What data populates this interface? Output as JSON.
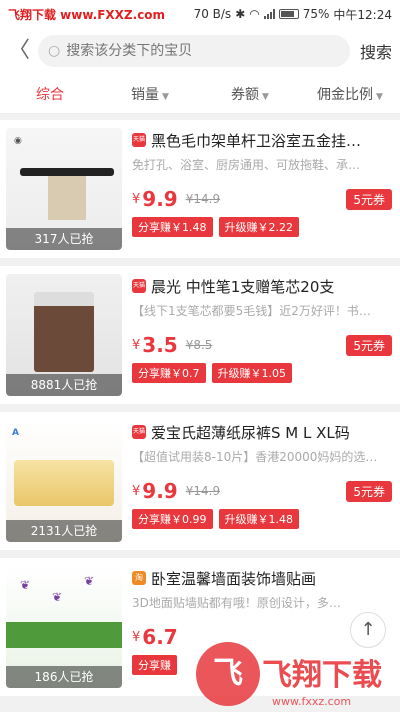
{
  "status_bar": {
    "watermark": "飞翔下载 www.FXXZ.com",
    "speed": "70 B/s",
    "battery": "75%",
    "time": "中午12:24"
  },
  "header": {
    "back_icon": "chevron-left-icon",
    "search_placeholder": "搜索该分类下的宝贝",
    "search_button": "搜索"
  },
  "sort_tabs": [
    {
      "label": "综合",
      "active": true
    },
    {
      "label": "销量",
      "active": false
    },
    {
      "label": "券额",
      "active": false
    },
    {
      "label": "佣金比例",
      "active": false
    }
  ],
  "products": [
    {
      "platform": "天猫",
      "title": "黑色毛巾架单杆卫浴室五金挂…",
      "desc": "免打孔、浴室、厨房通用、可放拖鞋、承…",
      "sold": "317人已抢",
      "yen": "¥",
      "price": "9.9",
      "orig": "¥14.9",
      "coupon": "5元券",
      "share_earn": "分享赚￥1.48",
      "upgrade_earn": "升级赚￥2.22"
    },
    {
      "platform": "天猫",
      "title": "晨光 中性笔1支赠笔芯20支",
      "desc": "【线下1支笔芯都要5毛钱】近2万好评！书…",
      "sold": "8881人已抢",
      "yen": "¥",
      "price": "3.5",
      "orig": "¥8.5",
      "coupon": "5元券",
      "share_earn": "分享赚￥0.7",
      "upgrade_earn": "升级赚￥1.05"
    },
    {
      "platform": "天猫",
      "title": "爱宝氏超薄纸尿裤S M L XL码",
      "desc": "【超值试用装8-10片】香港20000妈妈的选…",
      "sold": "2131人已抢",
      "yen": "¥",
      "price": "9.9",
      "orig": "¥14.9",
      "coupon": "5元券",
      "share_earn": "分享赚￥0.99",
      "upgrade_earn": "升级赚￥1.48"
    },
    {
      "platform": "淘",
      "title": "卧室温馨墙面装饰墙贴画",
      "desc": "3D地面贴墙贴都有哦！原创设计，多…",
      "sold": "186人已抢",
      "yen": "¥",
      "price": "6.7",
      "orig": "",
      "coupon": "",
      "share_earn": "分享赚",
      "upgrade_earn": ""
    }
  ],
  "watermark_bottom": {
    "logo": "飞",
    "text": "飞翔下载",
    "url": "www.fxxz.com"
  },
  "colors": {
    "accent": "#e8383d",
    "page_bg": "#f1f1f1"
  }
}
